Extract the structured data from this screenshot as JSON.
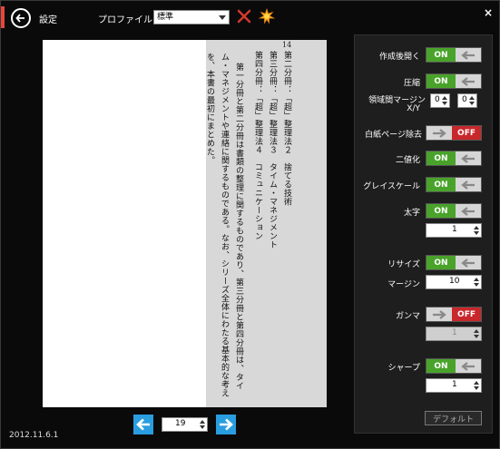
{
  "header": {
    "settings_label": "設定",
    "profile_label": "プロファイル",
    "profile_value": "標準",
    "close_glyph": "×",
    "accent_color": "#e5473d"
  },
  "preview": {
    "page_number": "14",
    "lines": [
      "第二分冊：「超」整理法２　捨てる技術",
      "第三分冊：「超」整理法３　タイム・マネジメント",
      "第四分冊：「超」整理法４　コミュニケーション",
      "第一分冊と第二分冊は書類の整理に関するものであり、第三分冊と第四分冊は、タイ",
      "ム・マネジメントや連絡に関するものである。なお、シリーズ全体にわたる基本的な考え",
      "を、本書の最初にまとめた。"
    ]
  },
  "nav": {
    "page_value": "19"
  },
  "version": "2012.11.6.1",
  "panel": {
    "open_after_create": {
      "label": "作成後開く",
      "state": "ON"
    },
    "compress": {
      "label": "圧縮",
      "state": "ON"
    },
    "margin_xy": {
      "label_line1": "領域間マージン",
      "label_line2": "X/Y",
      "x": "0",
      "y": "0"
    },
    "remove_blank": {
      "label": "白紙ページ除去",
      "state": "OFF"
    },
    "binarize": {
      "label": "二値化",
      "state": "ON"
    },
    "grayscale": {
      "label": "グレイスケール",
      "state": "ON"
    },
    "bold": {
      "label": "太字",
      "state": "ON",
      "value": "1"
    },
    "resize": {
      "label": "リサイズ",
      "state": "ON"
    },
    "margin": {
      "label": "マージン",
      "value": "10"
    },
    "gamma": {
      "label": "ガンマ",
      "state": "OFF",
      "value": "1"
    },
    "sharpen": {
      "label": "シャープ",
      "state": "ON",
      "value": "1"
    },
    "default_button": "デフォルト"
  }
}
